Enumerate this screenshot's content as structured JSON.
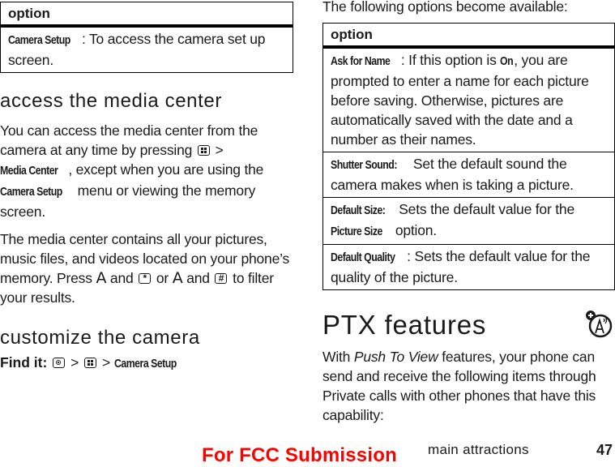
{
  "left": {
    "top_table": {
      "header": "option",
      "rows": [
        {
          "term": "Camera Setup",
          "desc": ": To access the camera set up screen."
        }
      ]
    },
    "media_center": {
      "heading": "access the media center",
      "p1": {
        "a": "You can access the media center from the camera at any time by pressing",
        "sep1": ">",
        "term1": "Media Center",
        "b": ", except when you are using the",
        "term2": "Camera Setup",
        "c": "menu or viewing the memory screen."
      },
      "p2": {
        "a": "The media center contains all your pictures, music files, and videos located on your phone’s memory. Press",
        "key_a": "A",
        "and1": "and",
        "star": "*",
        "or": "or",
        "key_a2": "A",
        "and2": "and",
        "hash": "#",
        "b": "to filter your results."
      }
    },
    "customize": {
      "heading": "customize the camera",
      "find_it_label": "Find it:",
      "sep": ">",
      "path_term": "Camera Setup"
    }
  },
  "right": {
    "intro": "The following options become available:",
    "table": {
      "header": "option",
      "rows": [
        {
          "term": "Ask for Name",
          "mid_a": ": If this option is ",
          "term2": "On",
          "desc": ", you are prompted to enter a name for each picture before saving. Otherwise, pictures are automatically saved with the date and a number as their names."
        },
        {
          "term": "Shutter Sound:",
          "desc": " Set the default sound the camera makes when is taking a picture."
        },
        {
          "term": "Default Size:",
          "desc": " Sets the default value for the ",
          "term2": "Picture Size",
          "desc2": " option."
        },
        {
          "term": "Default Quality",
          "desc": ": Sets the default value for the quality of the picture."
        }
      ]
    },
    "ptx": {
      "heading": "PTX features",
      "icon": "ptx-network-feature-icon",
      "p": {
        "a": "With ",
        "em": "Push To View",
        "b": " features, your phone can send and receive the following items through Private calls with other phones that have this capability:"
      }
    }
  },
  "footer": {
    "watermark": "For FCC Submission",
    "watermark_color": "#ff0000",
    "section": "main attractions",
    "page_number": "47"
  }
}
